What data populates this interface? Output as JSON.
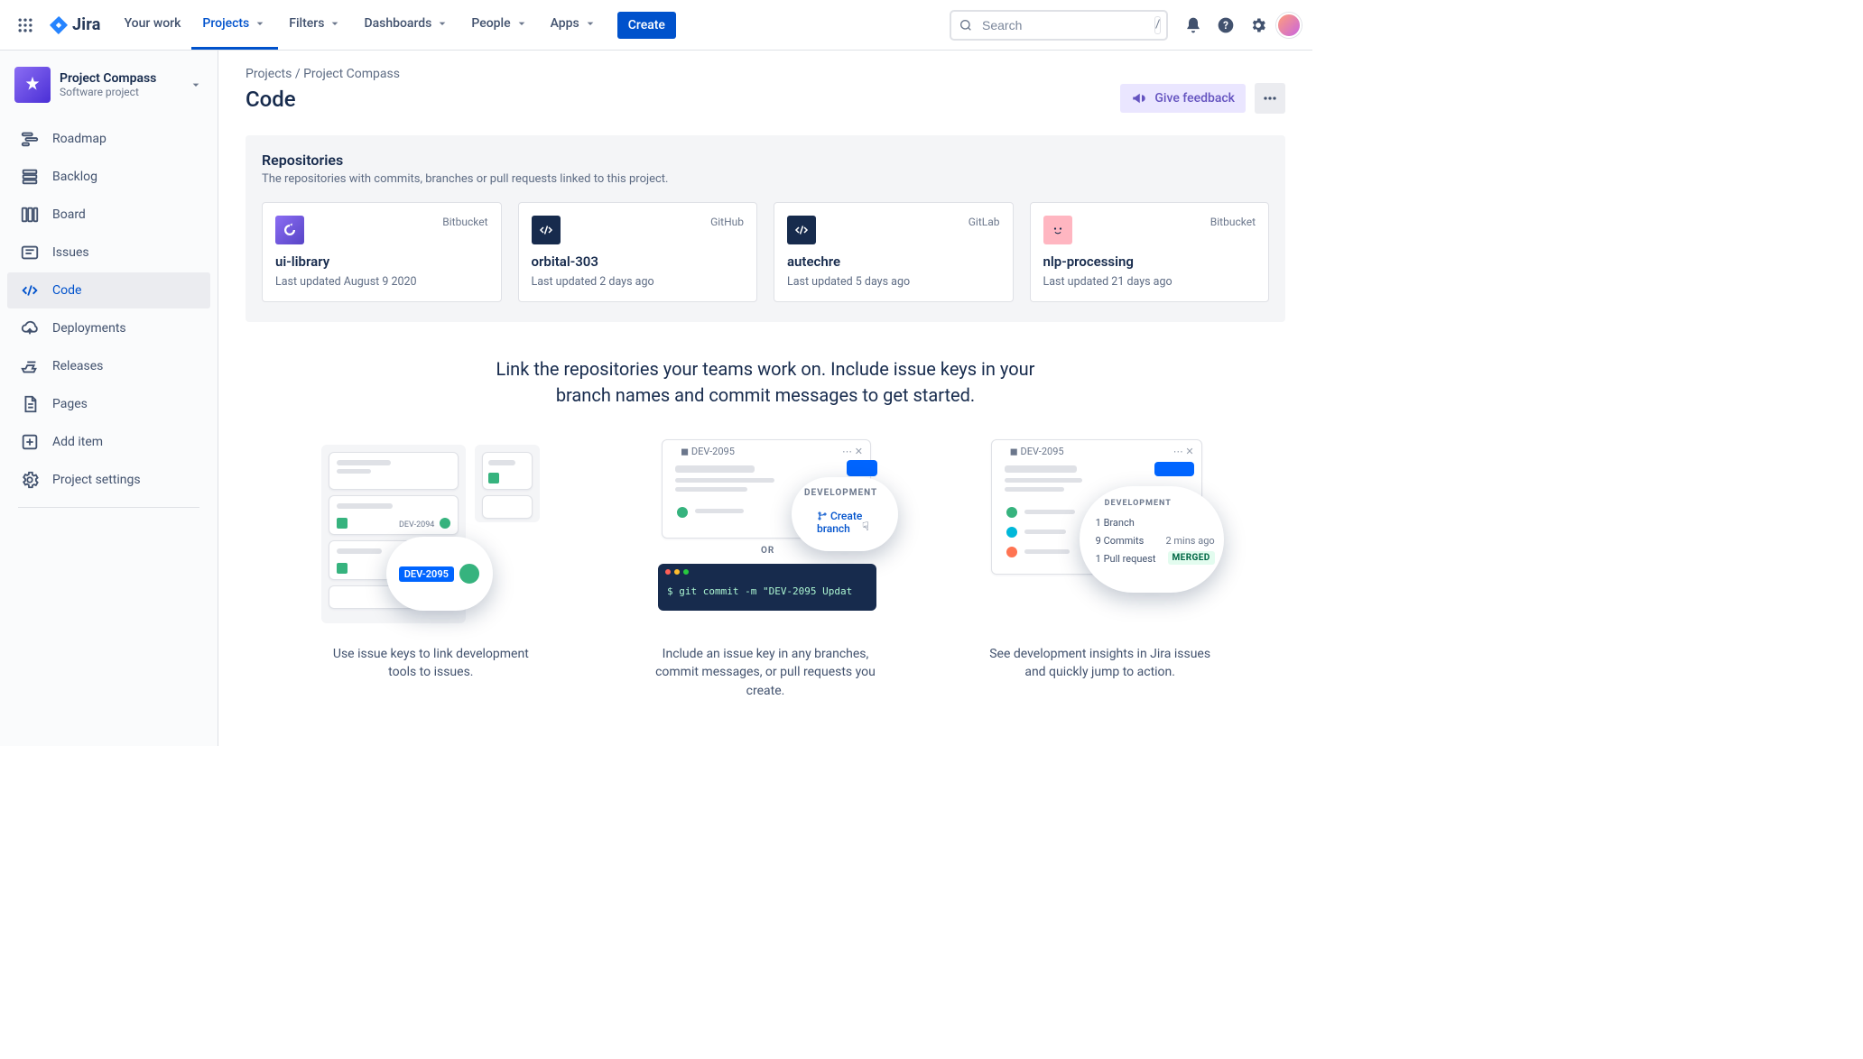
{
  "top": {
    "logo": "Jira",
    "nav": [
      "Your work",
      "Projects",
      "Filters",
      "Dashboards",
      "People",
      "Apps"
    ],
    "nav_has_caret": [
      false,
      true,
      true,
      true,
      true,
      true
    ],
    "nav_active_index": 1,
    "create": "Create",
    "search_placeholder": "Search",
    "shortcut_key": "/"
  },
  "project": {
    "name": "Project Compass",
    "type": "Software project"
  },
  "sidebar": {
    "items": [
      {
        "id": "roadmap",
        "label": "Roadmap"
      },
      {
        "id": "backlog",
        "label": "Backlog"
      },
      {
        "id": "board",
        "label": "Board"
      },
      {
        "id": "issues",
        "label": "Issues"
      },
      {
        "id": "code",
        "label": "Code"
      },
      {
        "id": "deployments",
        "label": "Deployments"
      },
      {
        "id": "releases",
        "label": "Releases"
      },
      {
        "id": "pages",
        "label": "Pages"
      },
      {
        "id": "add-item",
        "label": "Add item"
      },
      {
        "id": "project-settings",
        "label": "Project settings"
      }
    ],
    "selected_index": 4
  },
  "breadcrumb": {
    "root": "Projects",
    "project": "Project Compass"
  },
  "page": {
    "title": "Code",
    "feedback_label": "Give feedback"
  },
  "repos": {
    "title": "Repositories",
    "subtitle": "The repositories with commits, branches or pull requests linked to this project.",
    "cards": [
      {
        "source": "Bitbucket",
        "name": "ui-library",
        "updated": "Last updated August 9 2020",
        "icon": "bb-rotate"
      },
      {
        "source": "GitHub",
        "name": "orbital-303",
        "updated": "Last updated 2 days ago",
        "icon": "code-dark"
      },
      {
        "source": "GitLab",
        "name": "autechre",
        "updated": "Last updated 5 days ago",
        "icon": "code-dark"
      },
      {
        "source": "Bitbucket",
        "name": "nlp-processing",
        "updated": "Last updated 21 days ago",
        "icon": "face-pink"
      }
    ]
  },
  "onboard": {
    "headline": "Link the repositories your teams work on. Include issue keys in your branch names and commit messages to get started.",
    "captions": [
      "Use issue keys to link development tools to issues.",
      "Include an issue key in any branches, commit messages, or pull requests you create.",
      "See development insights in Jira issues and quickly jump to action."
    ],
    "illus": {
      "keys": {
        "k1": "DEV-2094",
        "k2": "DEV-2095"
      },
      "term_cmd": "$ git commit -m \"DEV-2095 Updat",
      "dev_section": "DEVELOPMENT",
      "create_branch": "Create branch",
      "or": "OR",
      "insights": {
        "branches": "1 Branch",
        "commits": "9 Commits",
        "prs": "1 Pull request",
        "time": "2 mins ago",
        "status": "MERGED"
      }
    }
  }
}
